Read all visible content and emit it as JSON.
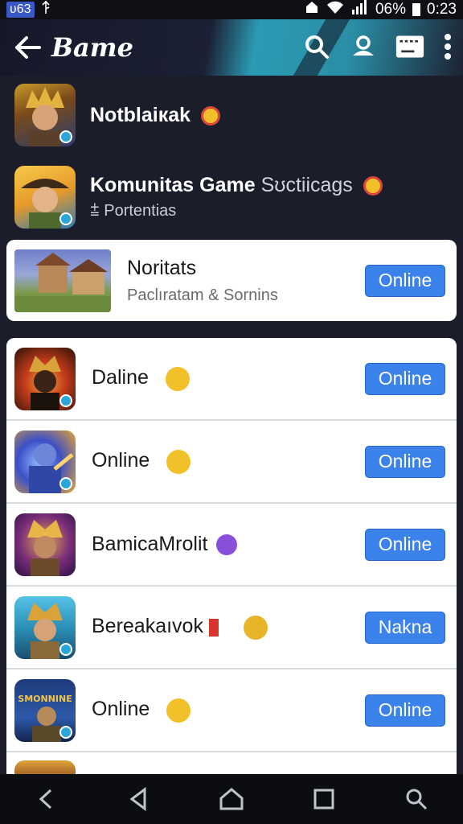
{
  "status_bar": {
    "carrier": "ʋ63",
    "battery": "06%",
    "time": "0:23"
  },
  "app_bar": {
    "title": "Bame",
    "icons": [
      "back-arrow-icon",
      "search-icon",
      "profile-icon",
      "keyboard-icon",
      "more-vert-icon"
    ]
  },
  "dark_items": [
    {
      "title": "Notblaікak",
      "subtitle": "",
      "emoji_color": "#f2c028"
    },
    {
      "title": "Komunitas Game",
      "title_extra": "Sʊctiicags",
      "subtitle": "⩲ Portentias",
      "emoji_color": "#f2c028"
    }
  ],
  "featured": {
    "title": "Noritats",
    "subtitle": "Paclıratam & Sornins",
    "button": "Online"
  },
  "list": [
    {
      "name": "Daline",
      "button": "Online",
      "emoji_color": "#f2c028"
    },
    {
      "name": "Online",
      "button": "Online",
      "emoji_color": "#f2c028"
    },
    {
      "name": "BamicaMrolit",
      "button": "Online",
      "emoji_color": "#8a4fd8"
    },
    {
      "name": "Bereakaıvok",
      "button": "Nakna",
      "emoji_color": "#e8b428"
    },
    {
      "name": "Online",
      "button": "Online",
      "emoji_color": "#f2c028"
    }
  ],
  "thumb_texts": {
    "smonnine": "SMONNINE"
  },
  "colors": {
    "accent": "#3b82ea",
    "background": "#1b1d2b",
    "card": "#ffffff"
  },
  "navigation": [
    "back-triangle-icon",
    "home-icon",
    "recents-icon",
    "search-icon"
  ]
}
